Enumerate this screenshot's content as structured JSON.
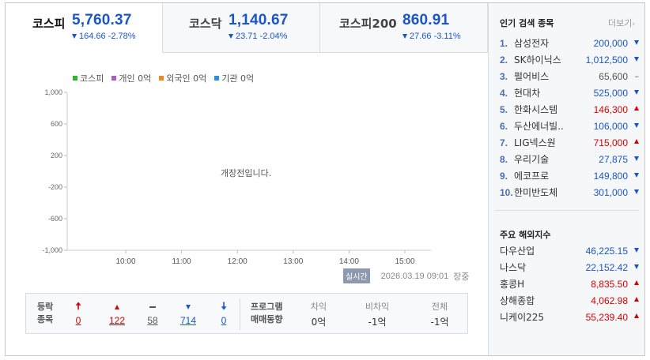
{
  "tabs": [
    {
      "name": "코스피",
      "value": "5,760.37",
      "change": "164.66 -2.78%",
      "active": true
    },
    {
      "name": "코스닥",
      "value": "1,140.67",
      "change": "23.71 -2.04%",
      "active": false
    },
    {
      "name": "코스피200",
      "value": "860.91",
      "change": "27.66 -3.11%",
      "active": false
    }
  ],
  "chart_data": {
    "type": "line",
    "legend": [
      {
        "label": "코스피",
        "color": "#2fb52f"
      },
      {
        "label": "개인 0억",
        "color": "#a35fd2"
      },
      {
        "label": "외국인 0억",
        "color": "#f2891f"
      },
      {
        "label": "기관 0억",
        "color": "#2b8de6"
      }
    ],
    "y_ticks": [
      "1,000",
      "600",
      "200",
      "-200",
      "-600",
      "-1,000"
    ],
    "x_ticks": [
      "10:00",
      "11:00",
      "12:00",
      "13:00",
      "14:00",
      "15:00"
    ],
    "ylim": [
      -1000,
      1000
    ],
    "series": [],
    "message": "개장전입니다."
  },
  "timestamp": {
    "badge": "실시간",
    "datetime": "2026.03.19 09:01",
    "status": "장중"
  },
  "stats": {
    "label_line1": "등락",
    "label_line2": "종목",
    "cols": [
      {
        "icon": "upper-limit-icon",
        "value": "0",
        "color": "#d90000"
      },
      {
        "icon": "rise-icon",
        "value": "122",
        "color": "#d90000"
      },
      {
        "icon": "flat-icon",
        "value": "58",
        "color": "#555555"
      },
      {
        "icon": "fall-icon",
        "value": "714",
        "color": "#1b56c5"
      },
      {
        "icon": "lower-limit-icon",
        "value": "0",
        "color": "#1b56c5"
      }
    ],
    "program_line1": "프로그램",
    "program_line2": "매매동향",
    "program": [
      {
        "head": "차익",
        "value": "0억"
      },
      {
        "head": "비차익",
        "value": "-1억"
      },
      {
        "head": "전체",
        "value": "-1억"
      }
    ]
  },
  "popular": {
    "title": "인기 검색 종목",
    "more": "더보기",
    "items": [
      {
        "rank": "1.",
        "name": "삼성전자",
        "price": "200,000",
        "dir": "down"
      },
      {
        "rank": "2.",
        "name": "SK하이닉스",
        "price": "1,012,500",
        "dir": "down"
      },
      {
        "rank": "3.",
        "name": "펄어비스",
        "price": "65,600",
        "dir": "flat"
      },
      {
        "rank": "4.",
        "name": "현대차",
        "price": "525,000",
        "dir": "down"
      },
      {
        "rank": "5.",
        "name": "한화시스템",
        "price": "146,300",
        "dir": "up"
      },
      {
        "rank": "6.",
        "name": "두산에너빌..",
        "price": "106,000",
        "dir": "down"
      },
      {
        "rank": "7.",
        "name": "LIG넥스원",
        "price": "715,000",
        "dir": "up"
      },
      {
        "rank": "8.",
        "name": "우리기술",
        "price": "27,875",
        "dir": "down"
      },
      {
        "rank": "9.",
        "name": "에코프로",
        "price": "149,800",
        "dir": "down"
      },
      {
        "rank": "10.",
        "name": "한미반도체",
        "price": "301,000",
        "dir": "down"
      }
    ]
  },
  "world": {
    "title": "주요 해외지수",
    "items": [
      {
        "name": "다우산업",
        "price": "46,225.15",
        "dir": "down"
      },
      {
        "name": "나스닥",
        "price": "22,152.42",
        "dir": "down"
      },
      {
        "name": "홍콩H",
        "price": "8,835.50",
        "dir": "up"
      },
      {
        "name": "상해종합",
        "price": "4,062.98",
        "dir": "up"
      },
      {
        "name": "니케이225",
        "price": "55,239.40",
        "dir": "up"
      }
    ]
  }
}
